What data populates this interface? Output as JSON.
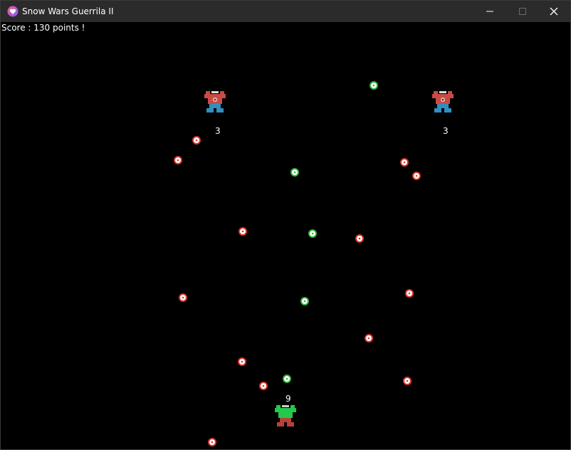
{
  "window": {
    "title": "Snow Wars Guerrila II",
    "icon": "heart-app-icon",
    "controls": [
      "minimize",
      "maximize",
      "close"
    ]
  },
  "hud": {
    "score_text": "Score : 130 points !"
  },
  "colors": {
    "enemy_ball": "#d9342a",
    "player_ball": "#2fb53a",
    "enemy_body": "#c94b45",
    "enemy_legs": "#2f8fbf",
    "player_body": "#22c94a",
    "player_legs": "#b84036",
    "titlebar": "#2b2b2b"
  },
  "units": [
    {
      "name": "enemy-left",
      "team": "enemy",
      "hp": "3"
    },
    {
      "name": "enemy-right",
      "team": "enemy",
      "hp": "3"
    },
    {
      "name": "player",
      "team": "player",
      "hp": "9"
    }
  ],
  "snowballs": {
    "enemy_count": 14,
    "player_count": 5
  }
}
